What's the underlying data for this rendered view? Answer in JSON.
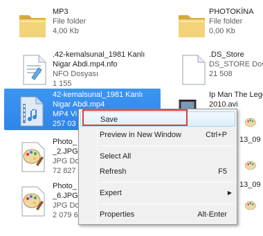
{
  "files": [
    {
      "id": "mp3",
      "title": "MP3",
      "type": "File folder",
      "meta": "4,00 Kb",
      "icon": "folder-icon"
    },
    {
      "id": "photokina",
      "title": "PHOTOKİNA",
      "type": "File folder",
      "meta": "0,00 Kb",
      "icon": "folder-icon"
    },
    {
      "id": "nfo",
      "title": ".42-kemalsunal_1981 Kanlı",
      "title2": "Nigar Abdi.mp4.nfo",
      "type": "NFO Dosyası",
      "meta": "1 155",
      "icon": "text-document-icon"
    },
    {
      "id": "ds_store",
      "title": ".DS_Store",
      "type": "DS_STORE Dosy",
      "meta": "21 508",
      "icon": "blank-document-icon"
    },
    {
      "id": "mp4",
      "title": "42-kemalsunal_1981 Kanlı",
      "title2": "Nigar Abdi.mp4",
      "type": "MP4 Vi",
      "meta": "257 03",
      "icon": "video-file-icon"
    },
    {
      "id": "ipman",
      "title": "Ip Man The Lege",
      "title2": "2010.avi",
      "icon": "video-file-icon"
    },
    {
      "id": "photo2",
      "title": "Photo_",
      "title2": "_2.JPG",
      "type": "JPG Do",
      "meta": "72 827",
      "icon": "paint-image-icon"
    },
    {
      "id": "photo6",
      "title": "Photo_",
      "title2": "_6.JPG",
      "type": "JPG Do",
      "meta": "2 079 6",
      "icon": "paint-image-icon"
    },
    {
      "id": "right1",
      "title": "13_09"
    },
    {
      "id": "right2",
      "title": "13_09"
    }
  ],
  "context_menu": {
    "items": [
      {
        "label": "Save",
        "shortcut": ""
      },
      {
        "label": "Preview in New Window",
        "shortcut": "Ctrl+P"
      },
      {
        "label": "Select All",
        "shortcut": ""
      },
      {
        "label": "Refresh",
        "shortcut": "F5"
      },
      {
        "label": "Expert",
        "shortcut": ""
      },
      {
        "label": "Properties",
        "shortcut": "Alt-Enter"
      }
    ],
    "submenu_arrow": "▶"
  },
  "colors": {
    "selection": "#2f85e6",
    "highlight_box": "#e03a3a",
    "folder": "#e8c25a"
  }
}
